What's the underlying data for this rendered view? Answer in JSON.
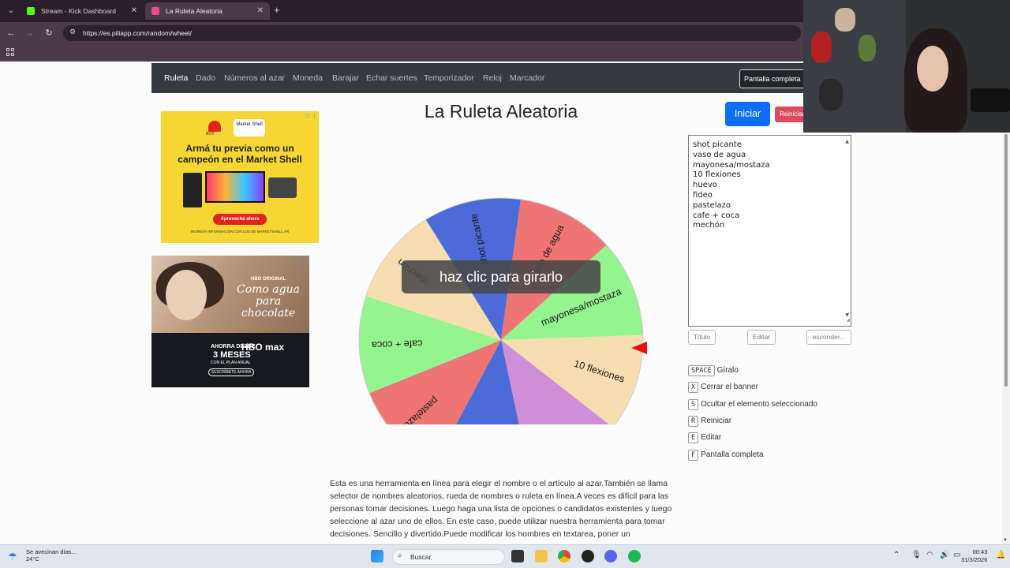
{
  "browser": {
    "tabs": [
      {
        "title": "Stream - Kick Dashboard",
        "favicon_color": "#53fc18",
        "active": false
      },
      {
        "title": "La Ruleta Aleatoria",
        "favicon_color": "#e84e89",
        "active": true
      }
    ],
    "url": "https://es.piliapp.com/random/wheel/"
  },
  "site": {
    "nav": [
      "Ruleta",
      "Dado",
      "Números al azar",
      "Moneda",
      "Barajar",
      "Echar suertes",
      "Temporizador",
      "Reloj",
      "Marcador"
    ],
    "fullscreen_label": "Pantalla completa"
  },
  "ads": {
    "shell": {
      "brand": "Market Shell",
      "box_label": "BOX",
      "headline": "Armá tu previa como un campeón en el Market Shell",
      "cta": "Aprovechá ahora",
      "fine_print": "INGRESÁ INFORMACIÓN CON LOS DE MARKETSHELL.AR"
    },
    "hbo": {
      "badge": "HBO ORIGINAL",
      "title": "Como agua para chocolate",
      "offer_line1": "AHORRA DESDE",
      "offer_line2": "3 MESES",
      "offer_line3": "CON EL PLAN ANUAL",
      "brand": "HBO max",
      "cta": "SUSCRÍBETE AHORA"
    }
  },
  "wheel": {
    "title": "La Ruleta Aleatoria",
    "banner": "haz clic para girarlo",
    "segments": [
      {
        "label": "shot picante",
        "color": "#4a6bd8"
      },
      {
        "label": "vaso de agua",
        "color": "#ef7575"
      },
      {
        "label": "mayonesa/mostaza",
        "color": "#94f58e"
      },
      {
        "label": "10 flexiones",
        "color": "#f6deb0"
      },
      {
        "label": "huevo",
        "color": "#d08ed6"
      },
      {
        "label": "fideo",
        "color": "#4a6bd8"
      },
      {
        "label": "pastelazo",
        "color": "#ef7575"
      },
      {
        "label": "cafe + coca",
        "color": "#94f58e"
      },
      {
        "label": "mechón",
        "color": "#f6deb0"
      }
    ],
    "pointer_color": "#e01414"
  },
  "controls": {
    "start_label": "Iniciar",
    "reset_label": "Reiniciar",
    "names": [
      "shot picante",
      "vaso de agua",
      "mayonesa/mostaza",
      "10 flexiones",
      "huevo",
      "fideo",
      "pastelazo",
      "cafe + coca",
      "mechón"
    ],
    "title_btn": "Título",
    "edit_btn": "Editar",
    "hide_btn": "esconder..."
  },
  "shortcuts": [
    {
      "key": "SPACE",
      "label": "Gíralo"
    },
    {
      "key": "X",
      "label": "Cerrar el banner"
    },
    {
      "key": "S",
      "label": "Ocultar el elemento seleccionado"
    },
    {
      "key": "R",
      "label": "Reiniciar"
    },
    {
      "key": "E",
      "label": "Editar"
    },
    {
      "key": "F",
      "label": "Pantalla completa"
    }
  ],
  "description": "Esta es una herramienta en línea para elegir el nombre o el artículo al azar.También se llama selector de nombres aleatorios, rueda de nombres o ruleta en línea.A veces es difícil para las personas tomar decisiones. Luego haga una lista de opciones o candidatos existentes y luego seleccione al azar uno de ellos. En este caso, puede utilizar nuestra herramienta para tomar decisiones. Sencillo y divertido.Puede modificar los nombres en textarea, poner un",
  "taskbar": {
    "weather_line1": "Se avecinan días...",
    "weather_line2": "24°C",
    "search_placeholder": "Buscar",
    "time": "00:43",
    "date": "31/3/2026"
  }
}
